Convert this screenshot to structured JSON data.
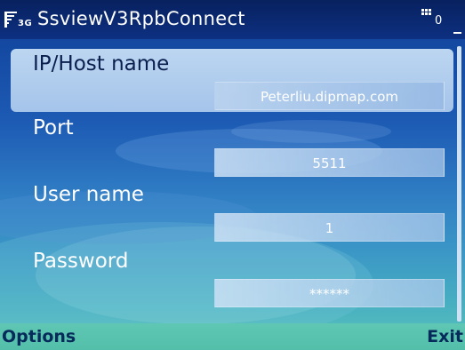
{
  "status": {
    "network_label": "3G",
    "counter": "0"
  },
  "app": {
    "title": "SsviewV3RpbConnect"
  },
  "form": {
    "host": {
      "label": "IP/Host name",
      "value": "Peterliu.dipmap.com"
    },
    "port": {
      "label": "Port",
      "value": "5511"
    },
    "user": {
      "label": "User name",
      "value": "1"
    },
    "password": {
      "label": "Password",
      "value": "******"
    }
  },
  "softkeys": {
    "left": "Options",
    "right": "Exit"
  },
  "icons": {
    "signal": "signal-strength-icon",
    "grid": "grid-menu-icon"
  },
  "colors": {
    "title_bar": "#0d3081",
    "highlight": "#bcd6f1",
    "softkey_bar": "#5fc7b4"
  }
}
